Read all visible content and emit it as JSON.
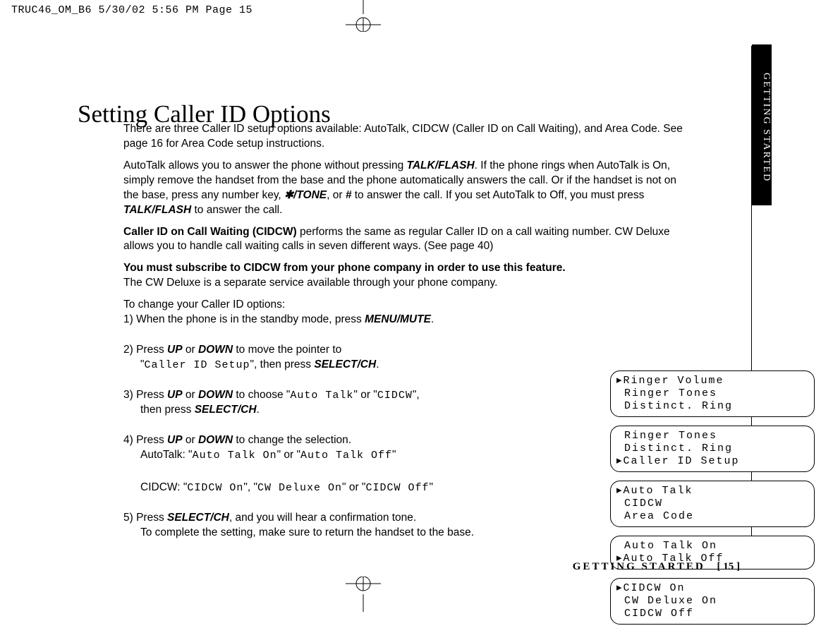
{
  "header": "TRUC46_OM_B6  5/30/02  5:56 PM  Page 15",
  "side_tab": "GETTING STARTED",
  "title": "Setting Caller ID Options",
  "p1": "There are three Caller ID setup options available: AutoTalk, CIDCW (Caller ID on Call Waiting), and Area Code. See page 16 for Area Code setup instructions.",
  "p2a": "AutoTalk allows you to answer the phone without pressing ",
  "p2b": ". If the phone rings when AutoTalk is On, simply remove the handset from the base and the phone automatically answers the call. Or if the handset is not on the base, press any number key, ",
  "p2c": ", or ",
  "p2d": " to answer the call. If you set AutoTalk to Off, you must press ",
  "p2e": " to answer the call.",
  "talkflash": "TALK/FLASH",
  "startone": "✱/TONE",
  "hash": "#",
  "p3a": "Caller ID on Call Waiting (CIDCW)",
  "p3b": " performs the same as regular Caller ID on a call waiting number. CW Deluxe allows you to handle call waiting calls in seven different ways. (See page 40)",
  "p4a": "You must subscribe to CIDCW from your phone company in order to use this feature.",
  "p4b": "The CW Deluxe is a separate service available through your phone company.",
  "steps_intro": "To change your Caller ID options:",
  "step1a": "1) When the phone is in the standby mode, press ",
  "step1b": ".",
  "menumute": "MENU/MUTE",
  "step2a": "2) Press ",
  "step2b": " or ",
  "step2c": " to move the pointer to",
  "step2d": "\"",
  "step2_ocr": "Caller ID Setup",
  "step2e": "\", then press ",
  "step2f": ".",
  "up": "UP",
  "down": "DOWN",
  "selectch": "SELECT/CH",
  "step3a": "3) Press ",
  "step3b": " or ",
  "step3c": " to choose \"",
  "step3_ocr1": "Auto Talk",
  "step3d": "\" or \"",
  "step3_ocr2": "CIDCW",
  "step3e": "\",",
  "step3f": "then press ",
  "step3g": ".",
  "step4a": "4) Press ",
  "step4b": " or ",
  "step4c": " to change the selection.",
  "step4d": "AutoTalk: \"",
  "step4_ocr1": "Auto Talk On",
  "step4e": "\" or \"",
  "step4_ocr2": "Auto Talk Off",
  "step4f": "\"",
  "step4g": "CIDCW: \"",
  "step4_ocr3": "CIDCW On",
  "step4h": "\", \"",
  "step4_ocr4": "CW Deluxe On",
  "step4i": "\" or \"",
  "step4_ocr5": "CIDCW Off",
  "step4j": "\"",
  "step5a": "5) Press ",
  "step5b": ", and you will hear a confirmation tone.",
  "step5c": "To complete the setting, make sure to return the handset to the base.",
  "lcd1_1": "▸Ringer Volume",
  "lcd1_2": " Ringer Tones",
  "lcd1_3": " Distinct. Ring",
  "lcd2_1": " Ringer Tones",
  "lcd2_2": " Distinct. Ring",
  "lcd2_3": "▸Caller ID Setup",
  "lcd3_1": "▸Auto Talk",
  "lcd3_2": " CIDCW",
  "lcd3_3": " Area Code",
  "lcd4_1": " Auto Talk On",
  "lcd4_2": "▸Auto Talk Off",
  "lcd5_1": "▸CIDCW On",
  "lcd5_2": " CW Deluxe On",
  "lcd5_3": " CIDCW Off",
  "footer_section": "GETTING STARTED",
  "footer_page": "[ 15 ]"
}
